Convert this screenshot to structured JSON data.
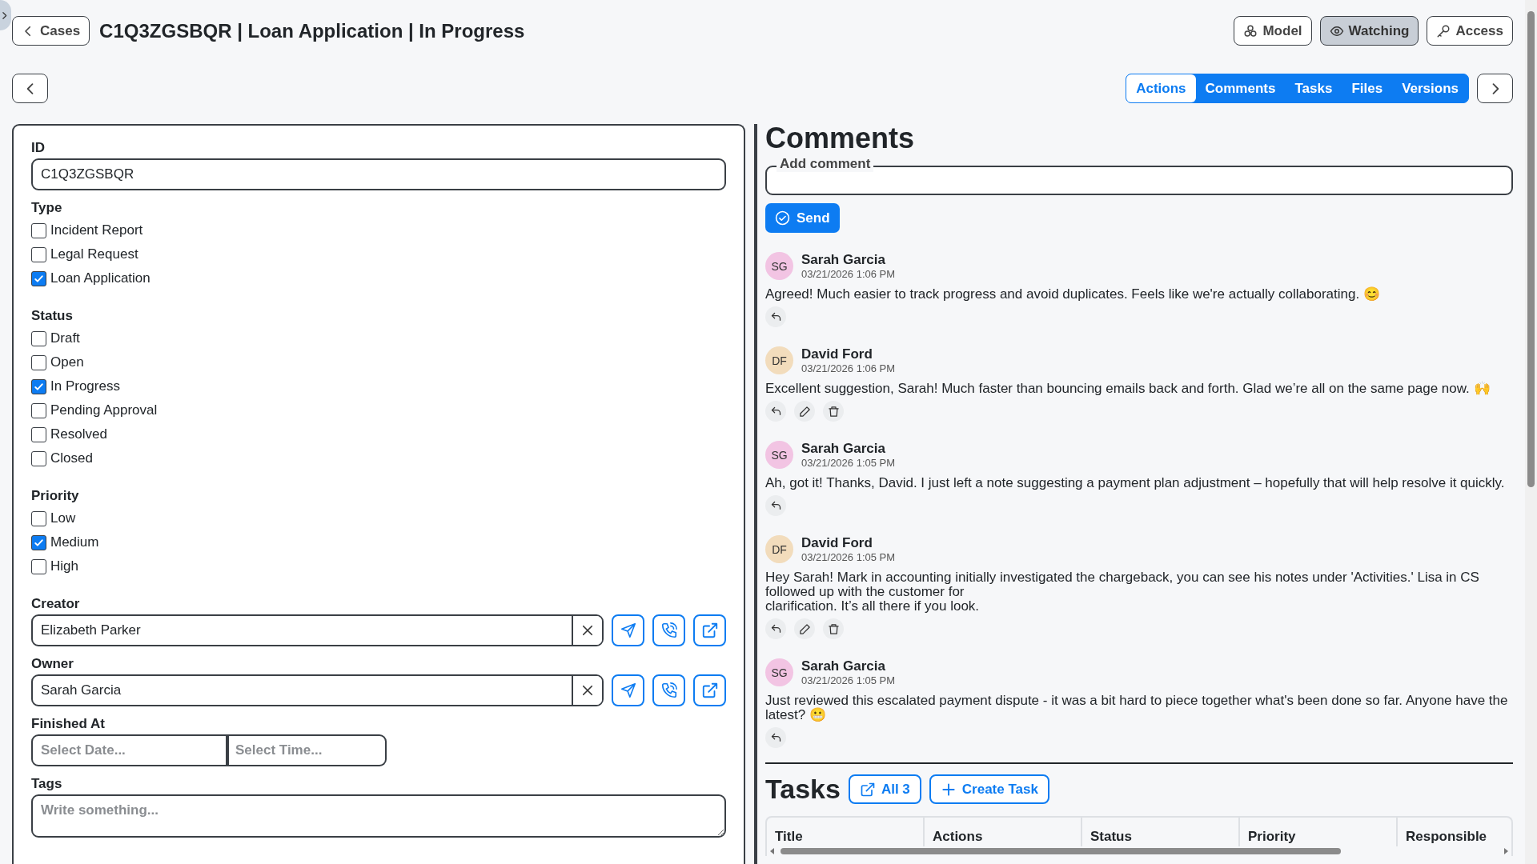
{
  "header": {
    "back_label": "Cases",
    "title": "C1Q3ZGSBQR | Loan Application | In Progress",
    "actions": [
      {
        "kind": "model",
        "label": "Model",
        "on": false
      },
      {
        "kind": "watch",
        "label": "Watching",
        "on": true
      },
      {
        "kind": "access",
        "label": "Access",
        "on": false
      }
    ]
  },
  "tabs": [
    {
      "label": "Actions",
      "selected": true
    },
    {
      "label": "Comments",
      "selected": false
    },
    {
      "label": "Tasks",
      "selected": false
    },
    {
      "label": "Files",
      "selected": false
    },
    {
      "label": "Versions",
      "selected": false
    }
  ],
  "form": [
    {
      "kind": "text",
      "label": "ID",
      "value": "C1Q3ZGSBQR"
    },
    {
      "kind": "checkboxes",
      "label": "Type",
      "options": [
        {
          "label": "Incident Report",
          "checked": false
        },
        {
          "label": "Legal Request",
          "checked": false
        },
        {
          "label": "Loan Application",
          "checked": true
        }
      ]
    },
    {
      "kind": "checkboxes",
      "label": "Status",
      "options": [
        {
          "label": "Draft",
          "checked": false
        },
        {
          "label": "Open",
          "checked": false
        },
        {
          "label": "In Progress",
          "checked": true
        },
        {
          "label": "Pending Approval",
          "checked": false
        },
        {
          "label": "Resolved",
          "checked": false
        },
        {
          "label": "Closed",
          "checked": false
        }
      ]
    },
    {
      "kind": "checkboxes",
      "label": "Priority",
      "options": [
        {
          "label": "Low",
          "checked": false
        },
        {
          "label": "Medium",
          "checked": true
        },
        {
          "label": "High",
          "checked": false
        }
      ]
    },
    {
      "kind": "person",
      "label": "Creator",
      "value": "Elizabeth Parker"
    },
    {
      "kind": "person",
      "label": "Owner",
      "value": "Sarah Garcia"
    },
    {
      "kind": "datetime",
      "label": "Finished At",
      "date_placeholder": "Select Date...",
      "time_placeholder": "Select Time..."
    },
    {
      "kind": "textarea",
      "label": "Tags",
      "placeholder": "Write something..."
    }
  ],
  "comments": {
    "title": "Comments",
    "add_label": "Add comment",
    "send_label": "Send",
    "items": [
      {
        "initials": "SG",
        "color": "#f2c4e3",
        "author": "Sarah Garcia",
        "time": "03/21/2026 1:06 PM",
        "text": "Agreed! Much easier to track progress and avoid duplicates. Feels like we're actually collaborating. 😊",
        "actions": [
          {
            "kind": "reply"
          }
        ]
      },
      {
        "initials": "DF",
        "color": "#f2dcbc",
        "author": "David Ford",
        "time": "03/21/2026 1:06 PM",
        "text": "Excellent suggestion, Sarah! Much faster than bouncing emails back and forth. Glad we’re all on the same page now. 🙌",
        "actions": [
          {
            "kind": "reply"
          },
          {
            "kind": "edit"
          },
          {
            "kind": "delete"
          }
        ]
      },
      {
        "initials": "SG",
        "color": "#f2c4e3",
        "author": "Sarah Garcia",
        "time": "03/21/2026 1:05 PM",
        "text": "Ah, got it! Thanks, David. I just left a note suggesting a payment plan adjustment – hopefully that will help resolve it quickly.",
        "actions": [
          {
            "kind": "reply"
          }
        ]
      },
      {
        "initials": "DF",
        "color": "#f2dcbc",
        "author": "David Ford",
        "time": "03/21/2026 1:05 PM",
        "text": "Hey Sarah! Mark in accounting initially investigated the chargeback, you can see his notes under 'Activities.' Lisa in CS followed up with the customer for\nclarification. It’s all there if you look.",
        "actions": [
          {
            "kind": "reply"
          },
          {
            "kind": "edit"
          },
          {
            "kind": "delete"
          }
        ]
      },
      {
        "initials": "SG",
        "color": "#f2c4e3",
        "author": "Sarah Garcia",
        "time": "03/21/2026 1:05 PM",
        "text": "Just reviewed this escalated payment dispute - it was a bit hard to piece together what's been done so far. Anyone have the latest? 😬",
        "actions": [
          {
            "kind": "reply"
          }
        ]
      }
    ]
  },
  "tasks": {
    "title": "Tasks",
    "all_label": "All 3",
    "create_label": "Create Task",
    "columns": [
      "Title",
      "Actions",
      "Status",
      "Priority",
      "Responsible"
    ]
  }
}
